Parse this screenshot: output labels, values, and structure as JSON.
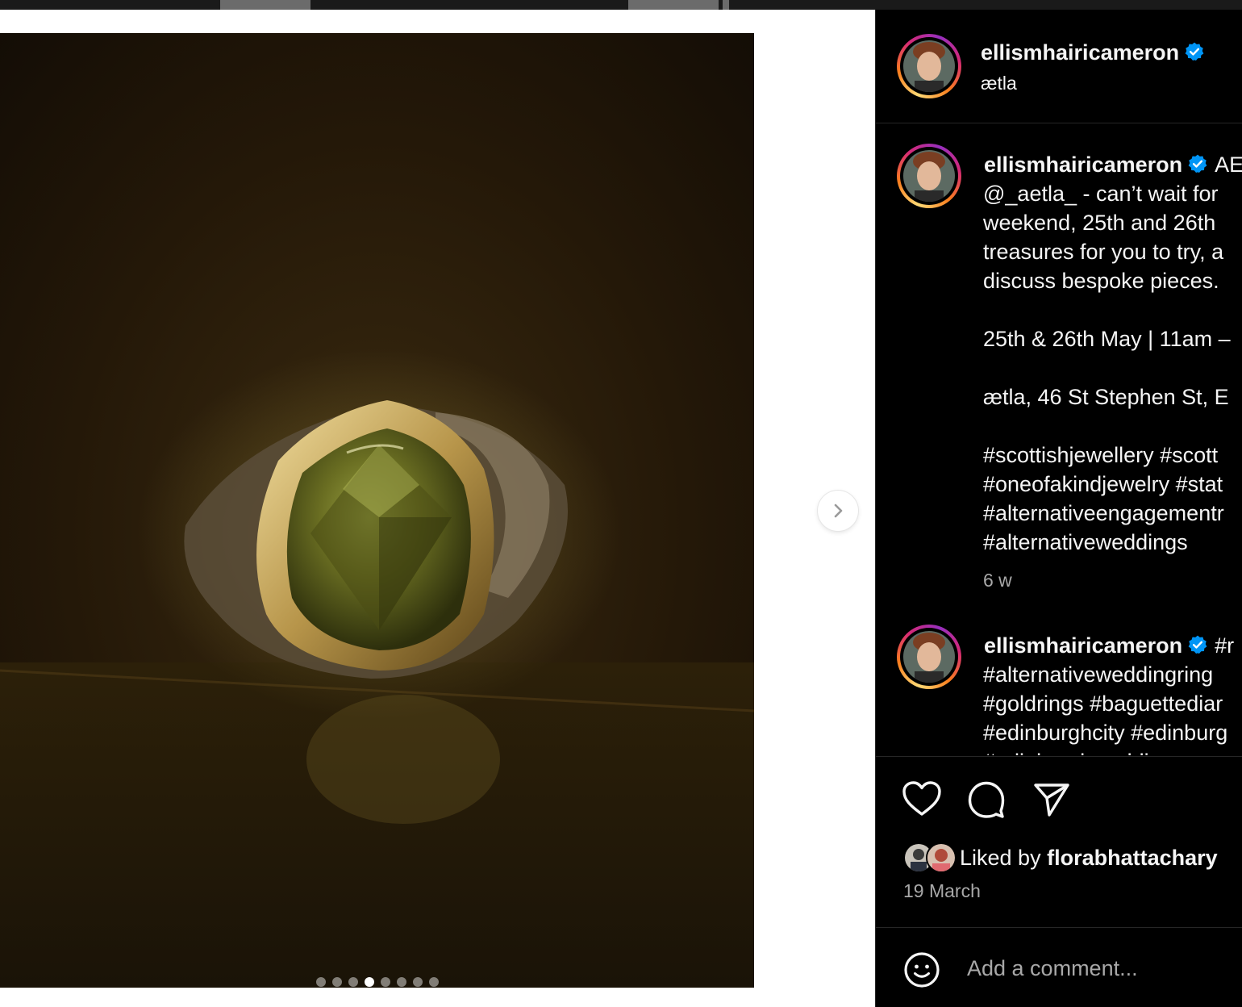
{
  "post": {
    "username": "ellismhairicameron",
    "location": "ætla",
    "carousel": {
      "count": 8,
      "active_index": 3
    }
  },
  "comments": [
    {
      "username": "ellismhairicameron",
      "text_first_line": "AE",
      "lines": [
        "@_aetla_ - can’t wait for",
        "weekend, 25th and 26th",
        "treasures for you to try, a",
        "discuss bespoke pieces.",
        "",
        "25th & 26th May | 11am –",
        "",
        "ætla, 46 St Stephen St, E",
        "",
        "#scottishjewellery #scott",
        "#oneofakindjewelry #stat",
        "#alternativeengagementr",
        "#alternativeweddings"
      ],
      "age": "6 w"
    },
    {
      "username": "ellismhairicameron",
      "text_first_line": "#r",
      "lines": [
        "#alternativeweddingring",
        "#goldrings #baguettediar",
        "#edinburghcity #edinburg",
        "#edinburghwedding"
      ]
    }
  ],
  "likes": {
    "prefix": "Liked by ",
    "user": "florabhattachary"
  },
  "date": "19 March",
  "add_comment_placeholder": "Add a comment...",
  "icons": [
    "heart-icon",
    "comment-icon",
    "share-icon",
    "emoji-icon",
    "chevron-right-icon",
    "verified-badge-icon"
  ],
  "colors": {
    "panel_bg": "#000000",
    "verified": "#0095f6",
    "muted_text": "#a8a8a8"
  }
}
